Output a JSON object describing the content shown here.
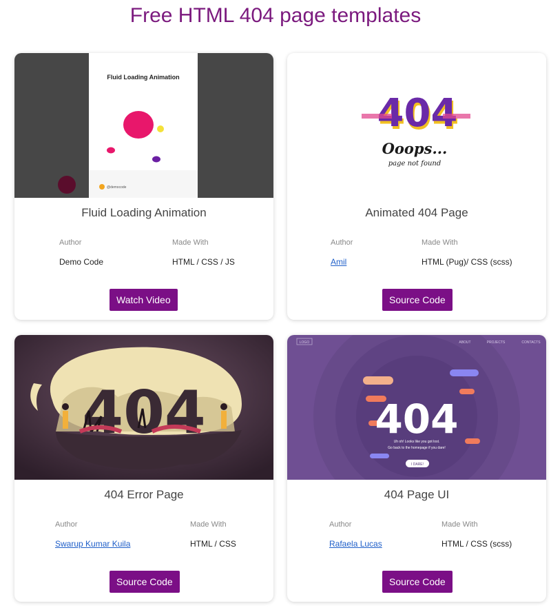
{
  "page": {
    "title": "Free HTML 404 page templates"
  },
  "labels": {
    "author": "Author",
    "made_with": "Made With"
  },
  "cards": [
    {
      "title": "Fluid Loading Animation",
      "author": "Demo Code",
      "author_is_link": false,
      "made_with": "HTML / CSS / JS",
      "button": "Watch Video",
      "thumb_heading": "Fluid Loading Animation",
      "thumb_credit": "@democode"
    },
    {
      "title": "Animated 404 Page",
      "author": "Amil",
      "author_is_link": true,
      "made_with": "HTML (Pug)/ CSS (scss)",
      "button": "Source Code",
      "thumb_code": "404",
      "thumb_oops": "Ooops...",
      "thumb_sub": "page not found"
    },
    {
      "title": "404 Error Page",
      "author": "Swarup Kumar Kuila",
      "author_is_link": true,
      "made_with": "HTML / CSS",
      "button": "Source Code",
      "thumb_code": "404"
    },
    {
      "title": "404 Page UI",
      "author": "Rafaela Lucas",
      "author_is_link": true,
      "made_with": "HTML / CSS (scss)",
      "button": "Source Code",
      "thumb_code": "404",
      "thumb_logo": "LOGO",
      "thumb_nav": [
        "ABOUT",
        "PROJECTS",
        "CONTACTS"
      ],
      "thumb_msg1": "Uh oh! Looks like you got lost.",
      "thumb_msg2": "Go back to the homepage if you dare!",
      "thumb_btn": "I DARE!"
    }
  ],
  "colors": {
    "title": "#7b1a7e",
    "button": "#7b0f86",
    "link": "#1f5fc9"
  }
}
